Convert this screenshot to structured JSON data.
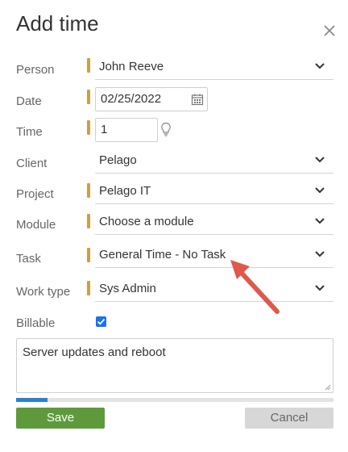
{
  "dialog": {
    "title": "Add time",
    "close_icon": "close-icon"
  },
  "fields": {
    "person": {
      "label": "Person",
      "value": "John Reeve"
    },
    "date": {
      "label": "Date",
      "value": "02/25/2022"
    },
    "time": {
      "label": "Time",
      "value": "1"
    },
    "client": {
      "label": "Client",
      "value": "Pelago"
    },
    "project": {
      "label": "Project",
      "value": "Pelago IT"
    },
    "module": {
      "label": "Module",
      "value": "Choose a module"
    },
    "task": {
      "label": "Task",
      "value": "General Time - No Task"
    },
    "work_type": {
      "label": "Work type",
      "value": "Sys Admin"
    },
    "billable": {
      "label": "Billable",
      "checked": true
    }
  },
  "notes": {
    "value": "Server updates and reboot"
  },
  "progress": {
    "percent": 10
  },
  "buttons": {
    "save": "Save",
    "cancel": "Cancel"
  },
  "colors": {
    "required_marker": "#c9a04a",
    "save": "#5e9a3c",
    "checkbox": "#1a73e8",
    "arrow": "#e0574c"
  }
}
